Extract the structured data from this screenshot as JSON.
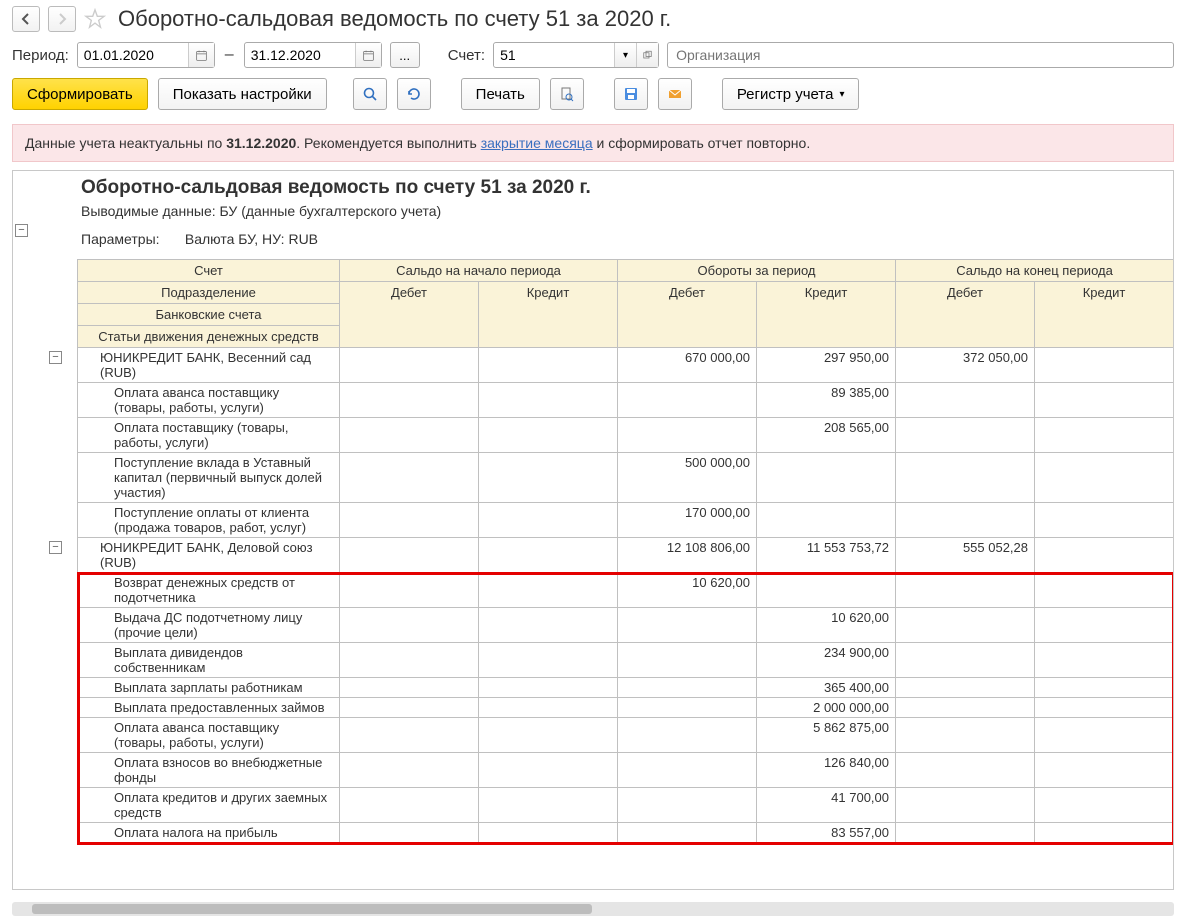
{
  "title": "Оборотно-сальдовая ведомость по счету 51 за 2020 г.",
  "period": {
    "label": "Период:",
    "from": "01.01.2020",
    "to": "31.12.2020",
    "dash": "–",
    "ellipsis": "..."
  },
  "account": {
    "label": "Счет:",
    "value": "51"
  },
  "org_placeholder": "Организация",
  "toolbar": {
    "form": "Сформировать",
    "settings": "Показать настройки",
    "print": "Печать",
    "register": "Регистр учета"
  },
  "warning": {
    "pre": "Данные учета неактуальны по ",
    "date": "31.12.2020",
    "mid": ". Рекомендуется выполнить ",
    "link": "закрытие месяца",
    "post": " и сформировать отчет повторно."
  },
  "report": {
    "title": "Оборотно-сальдовая ведомость по счету 51 за 2020 г.",
    "sub": "Выводимые данные: БУ (данные бухгалтерского учета)",
    "param_label": "Параметры:",
    "param_value": "Валюта БУ, НУ: RUB",
    "hdr": {
      "account": "Счет",
      "start": "Сальдо на начало периода",
      "turn": "Обороты за период",
      "end": "Сальдо на конец периода",
      "dept": "Подразделение",
      "bank": "Банковские счета",
      "flow": "Статьи движения денежных средств",
      "dt": "Дебет",
      "kt": "Кредит"
    },
    "rows": [
      {
        "lvl": 1,
        "name": "ЮНИКРЕДИТ БАНК, Весенний сад (RUB)",
        "sd": "",
        "sk": "",
        "td": "670 000,00",
        "tk": "297 950,00",
        "ed": "372 050,00",
        "ek": ""
      },
      {
        "lvl": 2,
        "name": "Оплата аванса поставщику (товары, работы, услуги)",
        "sd": "",
        "sk": "",
        "td": "",
        "tk": "89 385,00",
        "ed": "",
        "ek": ""
      },
      {
        "lvl": 2,
        "name": "Оплата поставщику (товары, работы, услуги)",
        "sd": "",
        "sk": "",
        "td": "",
        "tk": "208 565,00",
        "ed": "",
        "ek": ""
      },
      {
        "lvl": 2,
        "name": "Поступление вклада в Уставный капитал (первичный выпуск долей участия)",
        "sd": "",
        "sk": "",
        "td": "500 000,00",
        "tk": "",
        "ed": "",
        "ek": ""
      },
      {
        "lvl": 2,
        "name": "Поступление оплаты от клиента (продажа товаров, работ, услуг)",
        "sd": "",
        "sk": "",
        "td": "170 000,00",
        "tk": "",
        "ed": "",
        "ek": ""
      },
      {
        "lvl": 1,
        "name": "ЮНИКРЕДИТ БАНК, Деловой союз (RUB)",
        "sd": "",
        "sk": "",
        "td": "12 108 806,00",
        "tk": "11 553 753,72",
        "ed": "555 052,28",
        "ek": ""
      },
      {
        "lvl": 2,
        "name": "Возврат денежных средств от подотчетника",
        "sd": "",
        "sk": "",
        "td": "10 620,00",
        "tk": "",
        "ed": "",
        "ek": "",
        "hl": true
      },
      {
        "lvl": 2,
        "name": "Выдача ДС подотчетному лицу (прочие цели)",
        "sd": "",
        "sk": "",
        "td": "",
        "tk": "10 620,00",
        "ed": "",
        "ek": "",
        "hl": true
      },
      {
        "lvl": 2,
        "name": "Выплата дивидендов собственникам",
        "sd": "",
        "sk": "",
        "td": "",
        "tk": "234 900,00",
        "ed": "",
        "ek": "",
        "hl": true
      },
      {
        "lvl": 2,
        "name": "Выплата зарплаты работникам",
        "sd": "",
        "sk": "",
        "td": "",
        "tk": "365 400,00",
        "ed": "",
        "ek": "",
        "hl": true
      },
      {
        "lvl": 2,
        "name": "Выплата предоставленных займов",
        "sd": "",
        "sk": "",
        "td": "",
        "tk": "2 000 000,00",
        "ed": "",
        "ek": "",
        "hl": true
      },
      {
        "lvl": 2,
        "name": "Оплата аванса поставщику (товары, работы, услуги)",
        "sd": "",
        "sk": "",
        "td": "",
        "tk": "5 862 875,00",
        "ed": "",
        "ek": "",
        "hl": true
      },
      {
        "lvl": 2,
        "name": "Оплата взносов во внебюджетные фонды",
        "sd": "",
        "sk": "",
        "td": "",
        "tk": "126 840,00",
        "ed": "",
        "ek": "",
        "hl": true
      },
      {
        "lvl": 2,
        "name": "Оплата кредитов и других заемных средств",
        "sd": "",
        "sk": "",
        "td": "",
        "tk": "41 700,00",
        "ed": "",
        "ek": "",
        "hl": true
      },
      {
        "lvl": 2,
        "name": "Оплата налога на прибыль",
        "sd": "",
        "sk": "",
        "td": "",
        "tk": "83 557,00",
        "ed": "",
        "ek": "",
        "hl": true
      }
    ]
  }
}
